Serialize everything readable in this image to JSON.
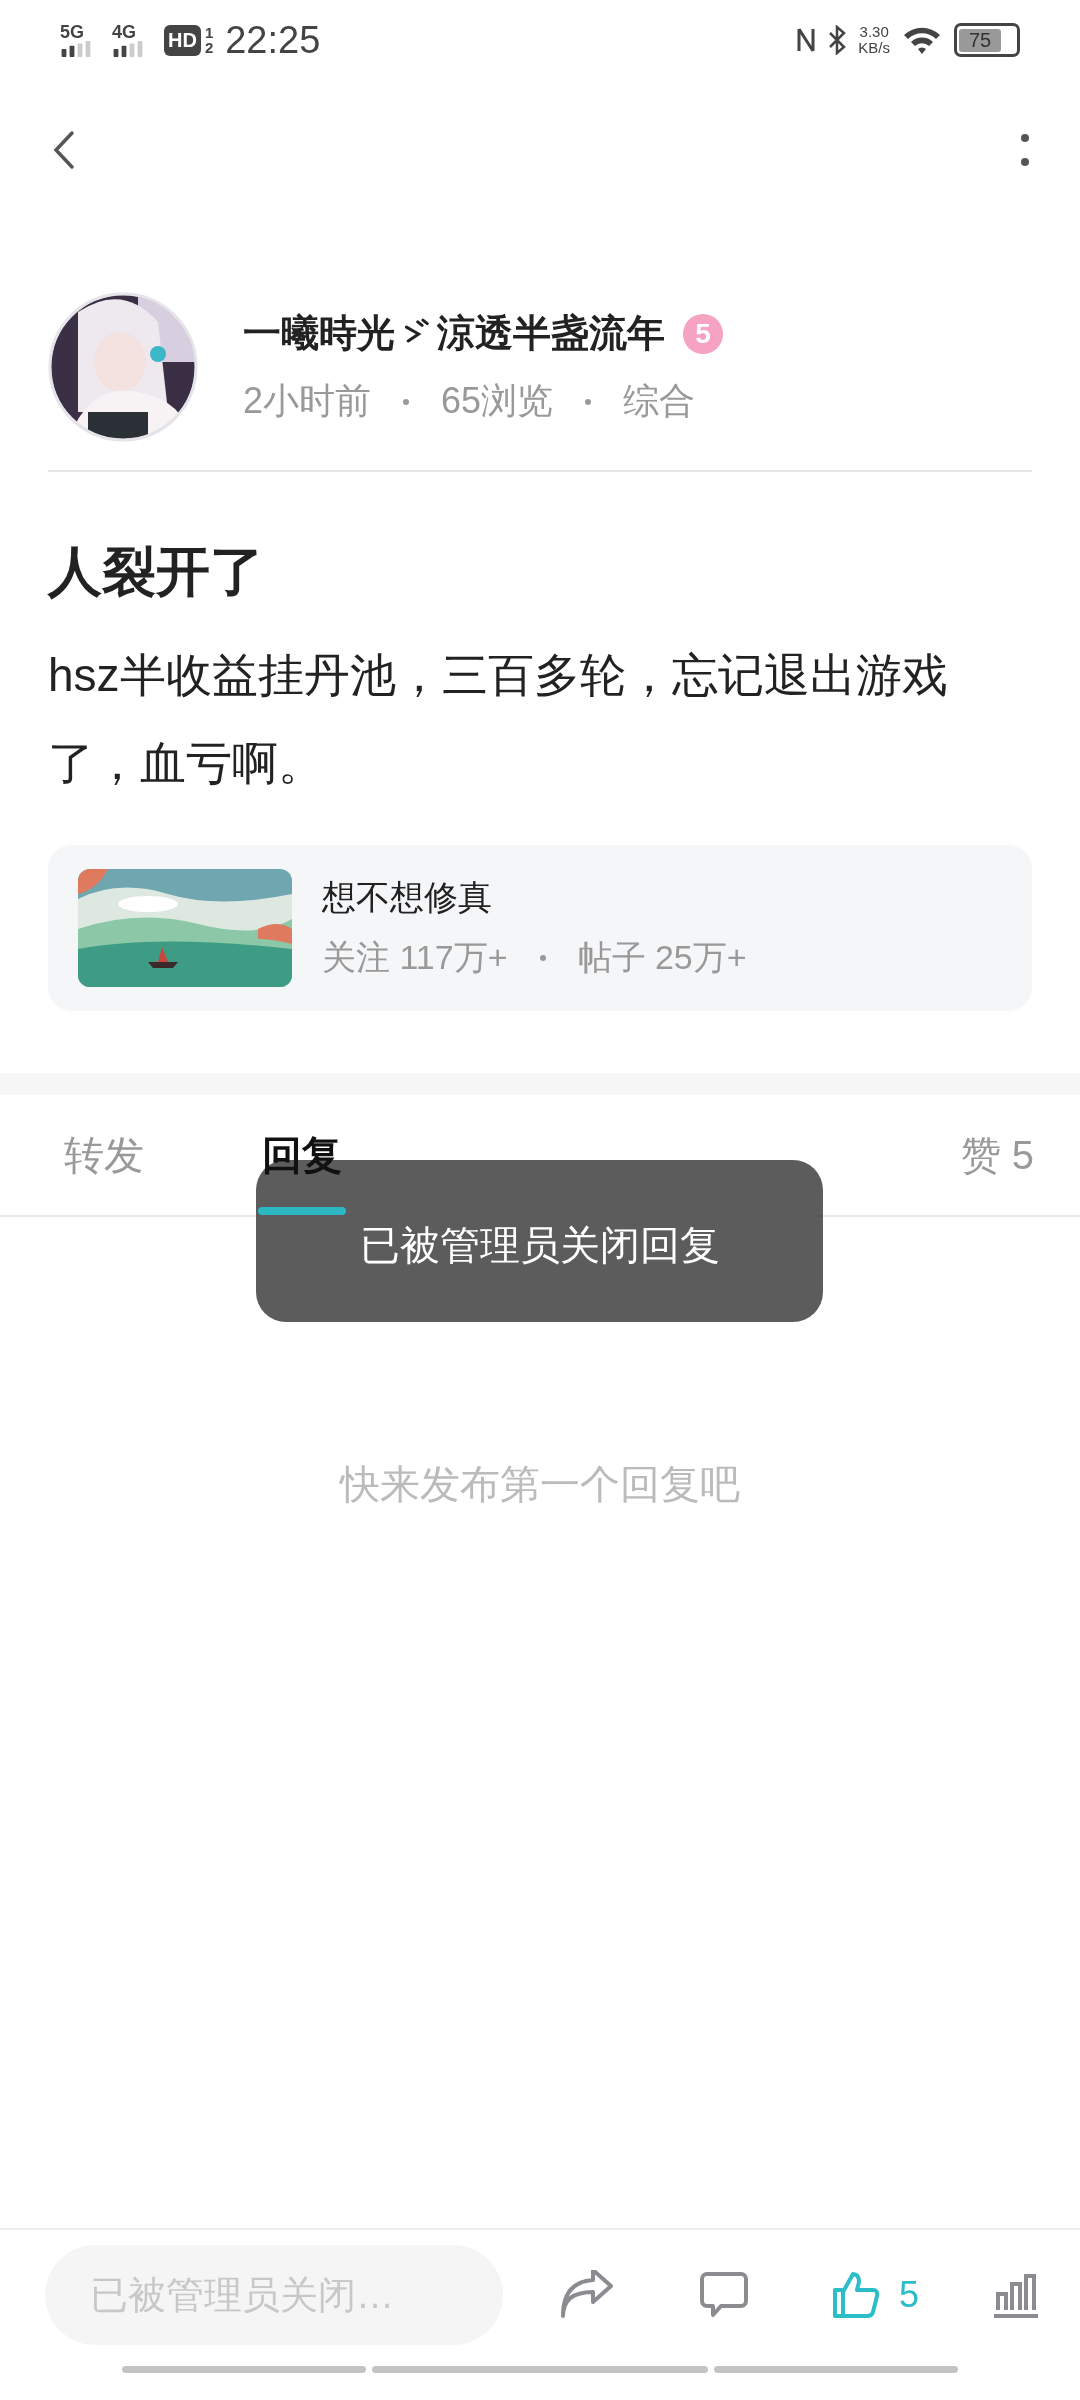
{
  "status_bar": {
    "networks": [
      "5G",
      "4G"
    ],
    "hd": "HD",
    "hd_sims": [
      "1",
      "2"
    ],
    "time": "22:25",
    "speed": "3.30",
    "speed_unit": "KB/s",
    "battery": "75"
  },
  "author": {
    "name_parts": [
      "一曦時光",
      "涼透半盏流年"
    ],
    "level_badge": "5",
    "meta": [
      "2小时前",
      "65浏览",
      "综合"
    ]
  },
  "post": {
    "title": "人裂开了",
    "body": "hsz半收益挂丹池，三百多轮，忘记退出游戏了，血亏啊。"
  },
  "circle": {
    "kind": "picture",
    "name": "想不想修真",
    "stats": [
      "关注 117万+",
      "帖子 25万+"
    ]
  },
  "tabs": [
    {
      "label": "转发",
      "selected": false
    },
    {
      "label": "回复",
      "selected": true
    },
    {
      "label": "赞 5",
      "selected": false
    }
  ],
  "toast": "已被管理员关闭回复",
  "empty_text": "快来发布第一个回复吧",
  "bottom_bar": {
    "placeholder": "已被管理员关闭…",
    "like_count": "5",
    "liked": true
  }
}
